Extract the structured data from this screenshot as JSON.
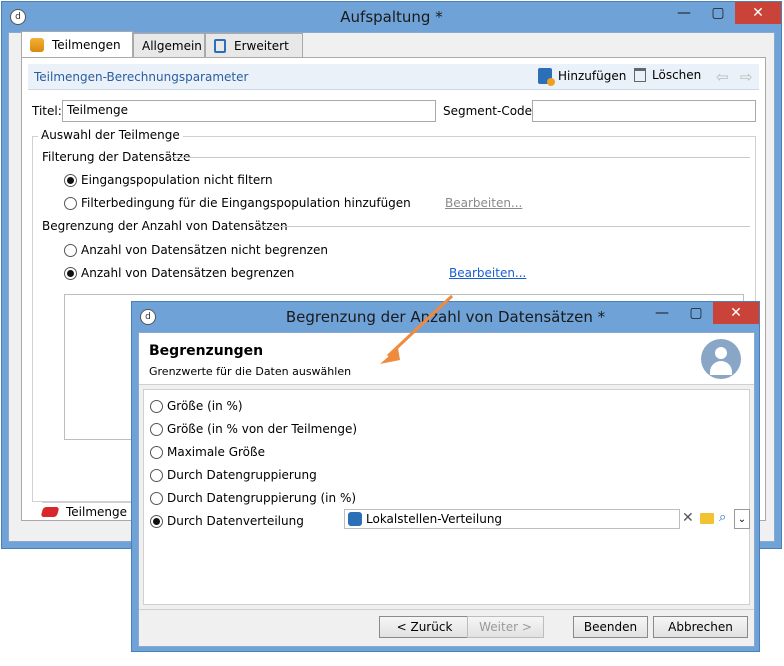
{
  "main_window": {
    "title": "Aufspaltung *",
    "tabs": [
      "Teilmengen",
      "Allgemein",
      "Erweitert"
    ],
    "section_title": "Teilmengen-Berechnungsparameter",
    "toolbar": {
      "add": "Hinzufügen",
      "delete": "Löschen"
    },
    "titel_label": "Titel:",
    "titel_value": "Teilmenge",
    "segment_code_label": "Segment-Code:",
    "segment_code_value": "",
    "group_label": "Auswahl der Teilmenge",
    "filter_section": "Filterung der Datensätze",
    "filter_opt1": "Eingangspopulation nicht filtern",
    "filter_opt2": "Filterbedingung für die Eingangspopulation hinzufügen",
    "filter_edit": "Bearbeiten...",
    "limit_section": "Begrenzung der Anzahl von Datensätzen",
    "limit_opt1": "Anzahl von Datensätzen nicht begrenzen",
    "limit_opt2": "Anzahl von Datensätzen begrenzen",
    "limit_edit": "Bearbeiten...",
    "bottom_tab": "Teilmenge"
  },
  "dialog": {
    "title": "Begrenzung der Anzahl von Datensätzen *",
    "header_title": "Begrenzungen",
    "header_subtitle": "Grenzwerte für die Daten auswählen",
    "options": [
      "Größe (in %)",
      "Größe (in % von der Teilmenge)",
      "Maximale Größe",
      "Durch Datengruppierung",
      "Durch Datengruppierung (in %)",
      "Durch Datenverteilung"
    ],
    "selected_index": 5,
    "distribution_value": "Lokalstellen-Verteilung",
    "buttons": {
      "back": "< Zurück",
      "next": "Weiter >",
      "finish": "Beenden",
      "cancel": "Abbrechen"
    }
  },
  "colors": {
    "frame": "#6fa3d8",
    "close": "#c94338",
    "link": "#1a5fcf",
    "arrow": "#f08a3c"
  }
}
